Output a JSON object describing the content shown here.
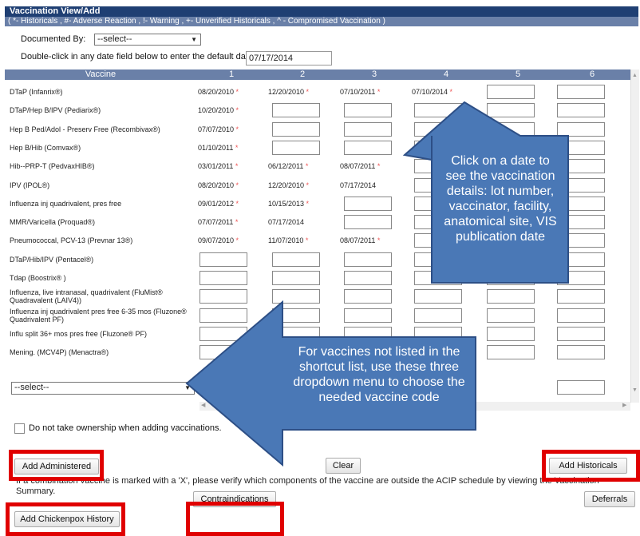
{
  "header": {
    "title": "Vaccination View/Add",
    "legend": "( *- Historicals , #- Adverse Reaction , !- Warning , +- Unverified Historicals , ^ - Compromised Vaccination )"
  },
  "documented_by": {
    "label": "Documented By:",
    "value": "--select--"
  },
  "default_date": {
    "label": "Double-click in any date field below to enter the default date:",
    "value": "07/17/2014"
  },
  "grid": {
    "vaccine_header": "Vaccine",
    "columns": [
      "1",
      "2",
      "3",
      "4",
      "5",
      "6"
    ],
    "rows": [
      {
        "name": "DTaP (Infanrix®)",
        "dates": [
          "08/20/2010 *",
          "12/20/2010 *",
          "07/10/2011 *",
          "07/10/2014 *",
          "",
          ""
        ]
      },
      {
        "name": "DTaP/Hep B/IPV (Pediarix®)",
        "dates": [
          "10/20/2010 *",
          "",
          "",
          "",
          "",
          ""
        ]
      },
      {
        "name": "Hep B Ped/Adol - Preserv Free (Recombivax®)",
        "dates": [
          "07/07/2010 *",
          "",
          "",
          "",
          "",
          ""
        ]
      },
      {
        "name": "Hep B/Hib (Comvax®)",
        "dates": [
          "01/10/2011 *",
          "",
          "",
          "",
          "",
          ""
        ]
      },
      {
        "name": "Hib--PRP-T (PedvaxHIB®)",
        "dates": [
          "03/01/2011 *",
          "06/12/2011 *",
          "08/07/2011 *",
          "",
          "",
          ""
        ]
      },
      {
        "name": "IPV (IPOL®)",
        "dates": [
          "08/20/2010 *",
          "12/20/2010 *",
          "07/17/2014",
          "",
          "",
          ""
        ]
      },
      {
        "name": "Influenza inj quadrivalent, pres free",
        "dates": [
          "09/01/2012 *",
          "10/15/2013 *",
          "",
          "",
          "",
          ""
        ]
      },
      {
        "name": "MMR/Varicella (Proquad®)",
        "dates": [
          "07/07/2011 *",
          "07/17/2014",
          "",
          "",
          "",
          ""
        ]
      },
      {
        "name": "Pneumococcal, PCV-13 (Prevnar 13®)",
        "dates": [
          "09/07/2010 *",
          "11/07/2010 *",
          "08/07/2011 *",
          "",
          "",
          ""
        ]
      },
      {
        "name": "DTaP/Hib/IPV (Pentacel®)",
        "dates": [
          "",
          "",
          "",
          "",
          "",
          ""
        ]
      },
      {
        "name": "Tdap (Boostrix® )",
        "dates": [
          "",
          "",
          "",
          "",
          "",
          ""
        ]
      },
      {
        "name": "Influenza, live intranasal, quadrivalent (FluMist® Quadravalent (LAIV4))",
        "dates": [
          "",
          "",
          "",
          "",
          "",
          ""
        ]
      },
      {
        "name": "Influenza inj quadrivalent pres free 6-35 mos (Fluzone® Quadrivalent PF)",
        "dates": [
          "",
          "",
          "",
          "",
          "",
          ""
        ]
      },
      {
        "name": "Influ split 36+ mos pres free (Fluzone® PF)",
        "dates": [
          "",
          "",
          "",
          "",
          "",
          ""
        ]
      },
      {
        "name": "Mening. (MCV4P) (Menactra®)",
        "dates": [
          "",
          "",
          "",
          "",
          "",
          ""
        ]
      }
    ],
    "select_row": {
      "value": "--select--"
    }
  },
  "ownership_checkbox": {
    "label": "Do not take ownership when adding vaccinations."
  },
  "buttons": {
    "add_administered": "Add Administered",
    "clear": "Clear",
    "add_historicals": "Add Historicals",
    "contraindications": "Contraindications",
    "deferrals": "Deferrals",
    "add_chickenpox": "Add Chickenpox History"
  },
  "combination_note": "If a combination vaccine is marked with a 'X', please verify which components of the vaccine are outside the ACIP schedule by viewing the Vaccination Summary.",
  "callouts": {
    "date_details": "Click on a date to see the vaccination details: lot number, vaccinator, facility, anatomical site, VIS publication date",
    "dropdown_help": "For vaccines not listed in the shortcut list, use these three dropdown menu to choose the needed vaccine code"
  },
  "colors": {
    "header_bg": "#1f3f73",
    "subheader_bg": "#6a80a8",
    "callout_fill": "#4a78b6",
    "highlight": "#e00000",
    "asterisk": "#e55555"
  }
}
